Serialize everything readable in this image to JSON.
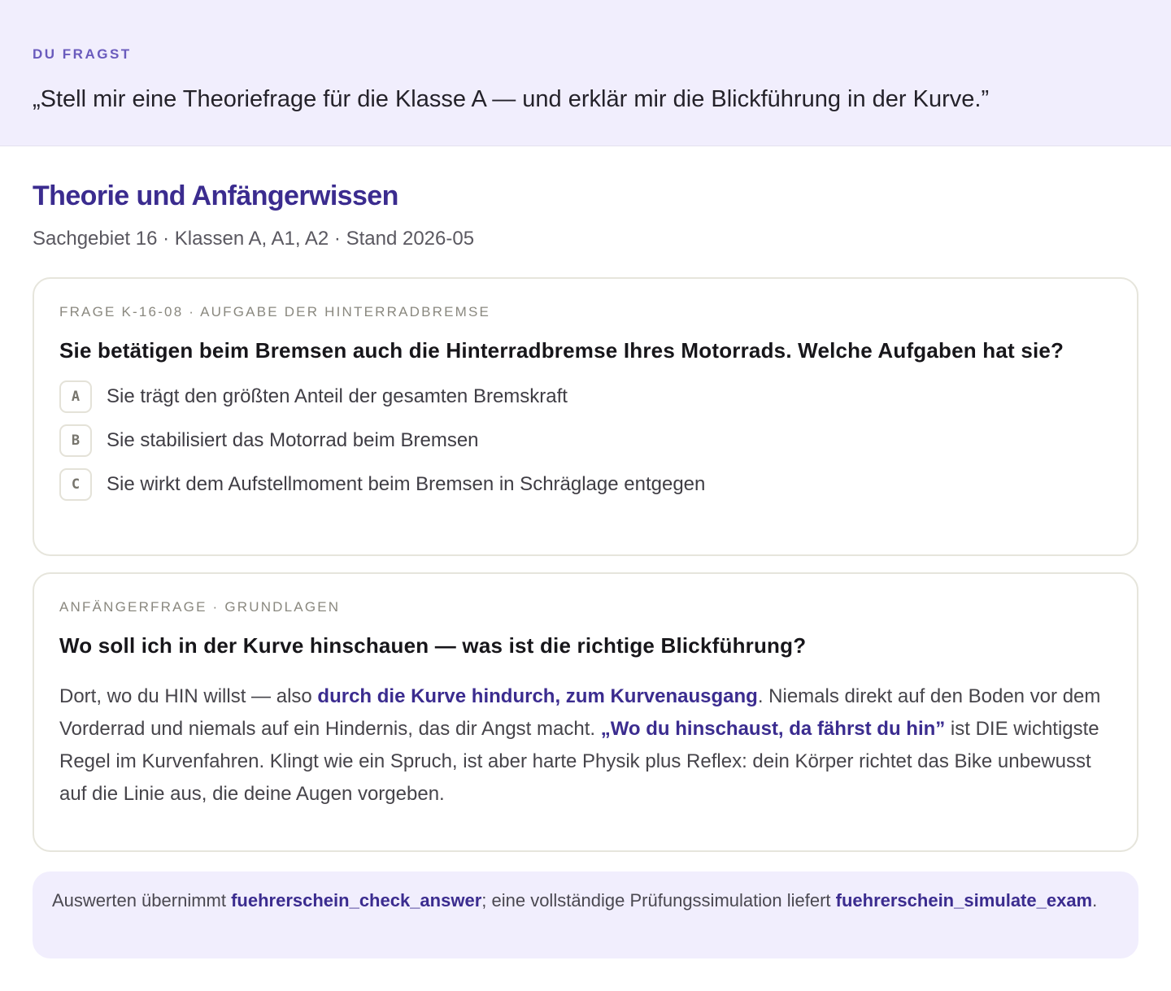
{
  "prompt": {
    "label": "DU FRAGST",
    "text": "„Stell mir eine Theoriefrage für die Klasse A — und erklär mir die Blickführung in der Kurve.”"
  },
  "section": {
    "title": "Theorie und Anfängerwissen",
    "meta": "Sachgebiet 16 · Klassen A, A1, A2 · Stand 2026-05"
  },
  "question_card": {
    "label": "FRAGE K-16-08 · AUFGABE DER HINTERRADBREMSE",
    "question": "Sie betätigen beim Bremsen auch die Hinterradbremse Ihres Motorrads. Welche Aufgaben hat sie?",
    "options": [
      {
        "letter": "A",
        "text": "Sie trägt den größten Anteil der gesamten Bremskraft"
      },
      {
        "letter": "B",
        "text": "Sie stabilisiert das Motorrad beim Bremsen"
      },
      {
        "letter": "C",
        "text": "Sie wirkt dem Aufstellmoment beim Bremsen in Schräglage entgegen"
      }
    ]
  },
  "beginner_card": {
    "label": "ANFÄNGERFRAGE · GRUNDLAGEN",
    "question": "Wo soll ich in der Kurve hinschauen — was ist die richtige Blickführung?",
    "answer": {
      "part1": "Dort, wo du HIN willst — also ",
      "highlight1": "durch die Kurve hindurch, zum Kurvenausgang",
      "part2": ". Niemals direkt auf den Boden vor dem Vorderrad und niemals auf ein Hindernis, das dir Angst macht. ",
      "highlight2": "„Wo du hinschaust, da fährst du hin”",
      "part3": " ist DIE wichtigste Regel im Kurvenfahren. Klingt wie ein Spruch, ist aber harte Physik plus Reflex: dein Körper richtet das Bike unbewusst auf die Linie aus, die deine Augen vorgeben."
    }
  },
  "footer": {
    "part1": "Auswerten übernimmt ",
    "tool1": "fuehrerschein_check_answer",
    "part2": "; eine vollständige Prüfungssimulation liefert ",
    "tool2": "fuehrerschein_simulate_exam",
    "part3": "."
  },
  "colors": {
    "accent": "#3b2c8f",
    "label_accent": "#6a5bbd",
    "prompt_background": "#f1eefd",
    "card_border": "#e6e5dc"
  }
}
